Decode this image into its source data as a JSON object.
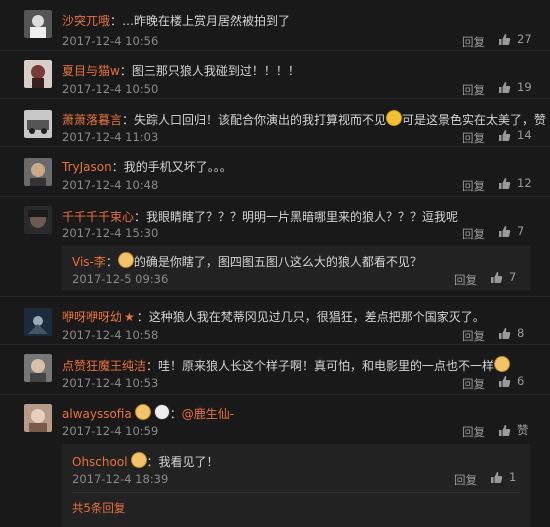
{
  "comments": [
    {
      "user": "沙突兀哦",
      "text": "…昨晚在楼上赏月居然被拍到了",
      "time": "2017-12-4 10:56",
      "reply": "回复",
      "likes": "27"
    },
    {
      "user": "夏目与猫w",
      "text": "图三那只狼人我碰到过！！！！",
      "time": "2017-12-4 10:50",
      "reply": "回复",
      "likes": "19"
    },
    {
      "user": "萧萧落暮言",
      "text": "失踪人口回归！该配合你演出的我打算视而不见",
      "text2": "可是这景色实在太美了，赞",
      "time": "2017-12-4 11:03",
      "reply": "回复",
      "likes": "14"
    },
    {
      "user": "TryJason",
      "text": "我的手机又坏了。。。",
      "time": "2017-12-4 10:48",
      "reply": "回复",
      "likes": "12"
    },
    {
      "user": "千千千千束心",
      "text": "我眼睛瞎了？？？明明一片黑暗哪里来的狼人？？？逗我呢",
      "time": "2017-12-4 15:30",
      "reply": "回复",
      "likes": "7",
      "sub": {
        "user": "Vis-李",
        "text": "的确是你瞎了，图四图五图八这么大的狼人都看不见？",
        "time": "2017-12-5 09:36",
        "reply": "回复",
        "likes": "7"
      }
    },
    {
      "user": "咿呀咿呀幼",
      "text": "这种狼人我在梵蒂冈见过几只，很猖狂，差点把那个国家灭了。",
      "time": "2017-12-4 10:58",
      "reply": "回复",
      "likes": "8"
    },
    {
      "user": "点赞狂魔王纯洁",
      "text": "哇！原来狼人长这个样子啊！真可怕，和电影里的一点也不一样",
      "time": "2017-12-4 10:53",
      "reply": "回复",
      "likes": "6"
    },
    {
      "user": "alwayssofia",
      "mention": "@鹿生仙-",
      "time": "2017-12-4 10:59",
      "reply": "回复",
      "likes": "赞",
      "sub": {
        "user": "Ohschool",
        "text": "我看见了！",
        "time": "2017-12-4 18:39",
        "reply": "回复",
        "likes": "1"
      },
      "more": "共5条回复"
    }
  ],
  "colors": {
    "username": "#e8713c",
    "background": "#191919",
    "subBackground": "#222222"
  }
}
